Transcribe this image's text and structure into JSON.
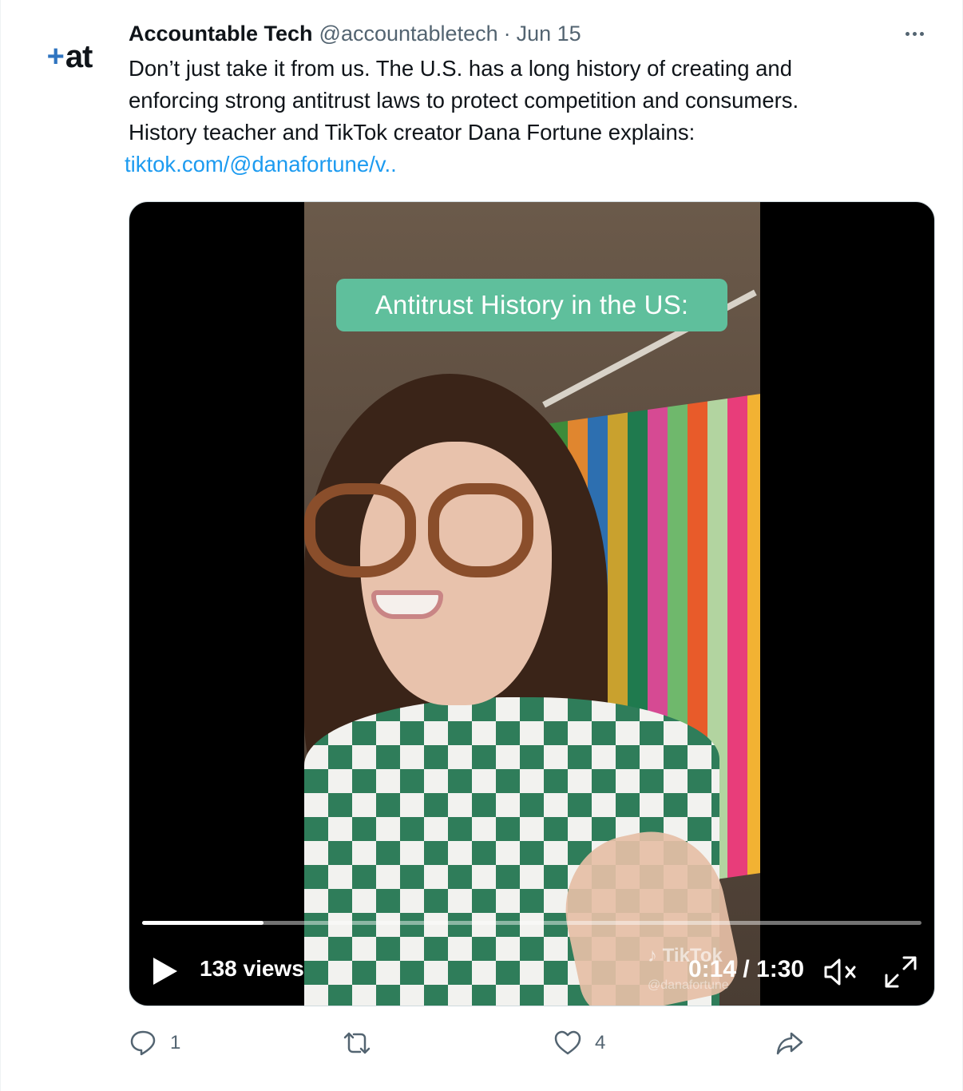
{
  "tweet": {
    "author_name": "Accountable Tech",
    "author_handle": "@accountabletech",
    "separator": "·",
    "date": "Jun 15",
    "avatar_plus": "+",
    "avatar_text": "at",
    "body_lines": [
      "Don’t just take it from us. The U.S. has a long history of creating and",
      "enforcing strong antitrust laws to protect competition and consumers.",
      "History teacher and TikTok creator Dana Fortune explains:"
    ],
    "link_text": "tiktok.com/@danafortune/v.."
  },
  "video": {
    "caption": "Antitrust History in the US:",
    "watermark": "TikTok",
    "watermark_handle": "@danafortune",
    "views": "138 views",
    "time": "0:14 / 1:30",
    "progress": 0.156,
    "play_icon": "play-icon",
    "mute_icon": "mute-icon",
    "expand_icon": "expand-icon"
  },
  "actions": {
    "reply_count": "1",
    "retweet_count": "",
    "like_count": "4",
    "icons": [
      "reply-icon",
      "retweet-icon",
      "like-icon",
      "share-icon"
    ]
  },
  "colors": {
    "link": "#1d9bf0",
    "secondary_text": "#536471",
    "brand_plus": "#2f74c0",
    "caption_pill": "#5fbf9c",
    "shirt_green": "#2f7d5a"
  }
}
